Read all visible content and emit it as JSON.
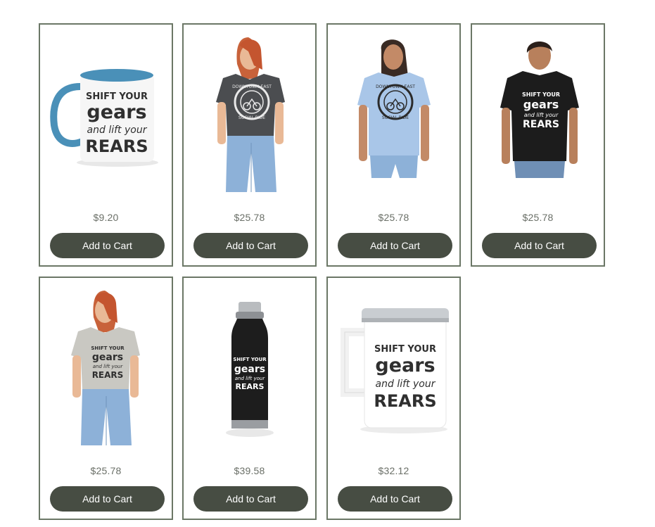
{
  "products": [
    {
      "image": "shift-your-gears-mug-blue",
      "graphic_text": [
        "SHIFT YOUR",
        "gears",
        "and lift your",
        "REARS"
      ],
      "price": "$9.20",
      "button_label": "Add to Cart",
      "accent": "#4a90b8"
    },
    {
      "image": "downtown-east-tee-charcoal",
      "graphic_text": [
        "DOWNTOWN EAST",
        "SOCIAL RIDE"
      ],
      "price": "$25.78",
      "button_label": "Add to Cart",
      "accent": "#4b4d50"
    },
    {
      "image": "downtown-east-tee-light-blue",
      "graphic_text": [
        "DOWNTOWN EAST",
        "SOCIAL RIDE"
      ],
      "price": "$25.78",
      "button_label": "Add to Cart",
      "accent": "#a9c6e8"
    },
    {
      "image": "shift-your-gears-tee-black",
      "graphic_text": [
        "SHIFT YOUR",
        "gears",
        "and lift your",
        "REARS"
      ],
      "price": "$25.78",
      "button_label": "Add to Cart",
      "accent": "#1c1c1c"
    },
    {
      "image": "shift-your-gears-tee-gray",
      "graphic_text": [
        "SHIFT YOUR",
        "gears",
        "and lift your",
        "REARS"
      ],
      "price": "$25.78",
      "button_label": "Add to Cart",
      "accent": "#c9c8c2"
    },
    {
      "image": "shift-your-gears-bottle-black",
      "graphic_text": [
        "SHIFT YOUR",
        "gears",
        "and lift your",
        "REARS"
      ],
      "price": "$39.58",
      "button_label": "Add to Cart",
      "accent": "#1d1d1d"
    },
    {
      "image": "shift-your-gears-travel-mug-white",
      "graphic_text": [
        "SHIFT YOUR",
        "gears",
        "and lift your",
        "REARS"
      ],
      "price": "$32.12",
      "button_label": "Add to Cart",
      "accent": "#ffffff"
    }
  ],
  "colors": {
    "card_border": "#6b7766",
    "button_bg": "#474d43",
    "price_text": "#6a6f67"
  }
}
